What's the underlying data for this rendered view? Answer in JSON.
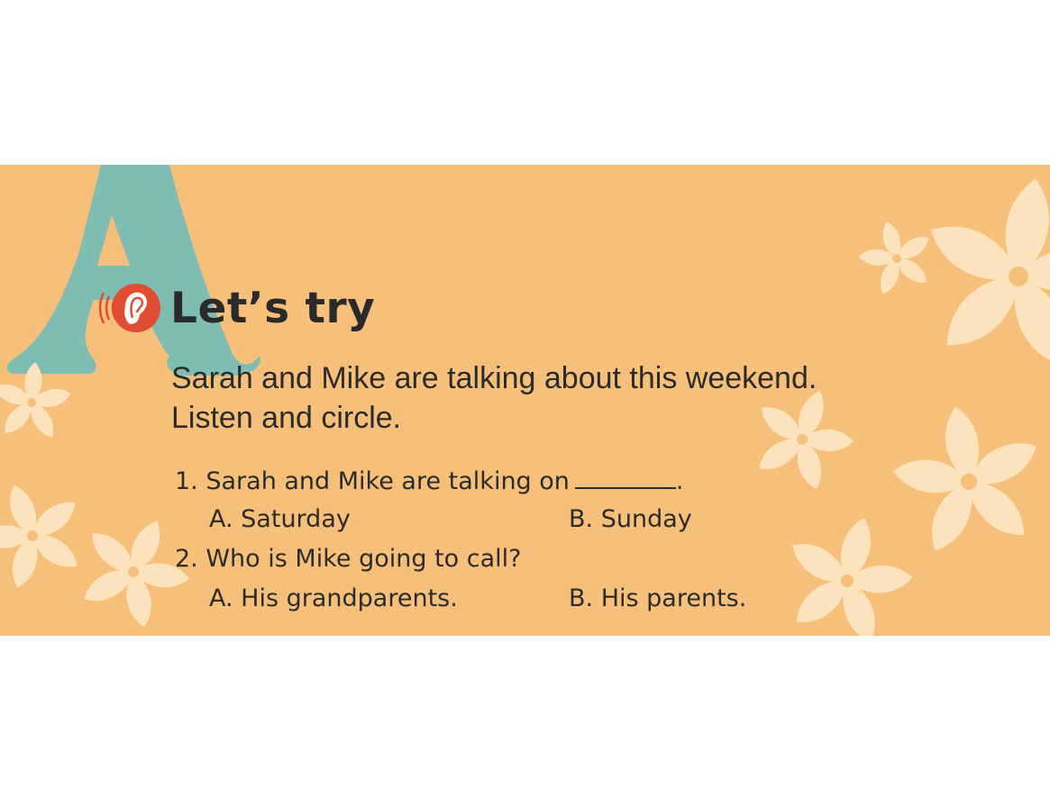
{
  "section": {
    "letter": "A",
    "title": "Let’s try",
    "listen_icon": "ear-icon"
  },
  "instruction": {
    "line1": "Sarah and Mike are talking about this weekend.",
    "line2": "Listen and circle."
  },
  "questions": [
    {
      "number": "1.",
      "text": "Sarah and Mike are talking on",
      "end": ".",
      "options": [
        {
          "label": "A.",
          "text": "Saturday"
        },
        {
          "label": "B.",
          "text": "Sunday"
        }
      ]
    },
    {
      "number": "2.",
      "text": "Who is Mike going to call?",
      "options": [
        {
          "label": "A.",
          "text": "His grandparents."
        },
        {
          "label": "B.",
          "text": "His parents."
        }
      ]
    }
  ],
  "colors": {
    "background": "#f6c07a",
    "letter": "#7fbcb4",
    "flower": "#fce2bd",
    "icon": "#e04d33",
    "text": "#2b2b2b"
  }
}
